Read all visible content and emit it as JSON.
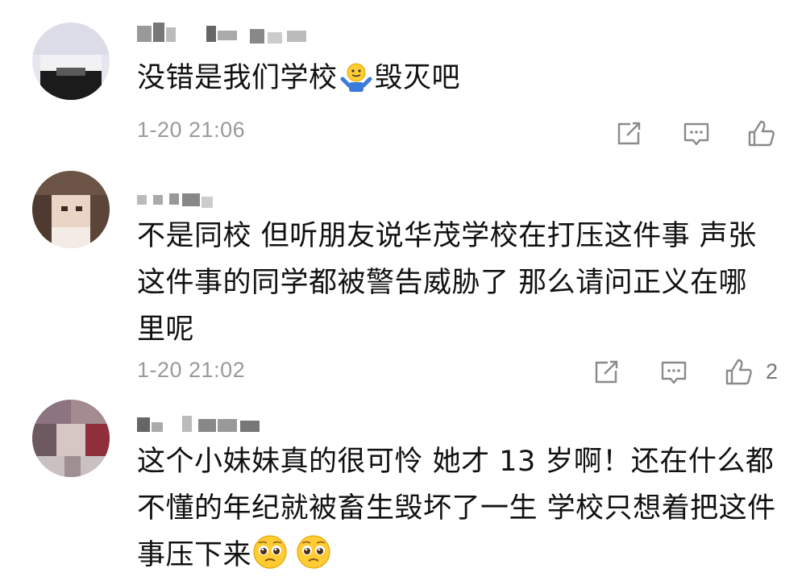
{
  "comments": [
    {
      "text_before_emoji": "没错是我们学校",
      "emoji_1": "shrug-emoji",
      "text_after_emoji": "毁灭吧",
      "time": "1-20 21:06",
      "like_count": ""
    },
    {
      "text": "不是同校 但听朋友说华茂学校在打压这件事 声张这件事的同学都被警告威胁了 那么请问正义在哪里呢",
      "time": "1-20 21:02",
      "like_count": "2"
    },
    {
      "text": "这个小妹妹真的很可怜 她才 13 岁啊！还在什么都不懂的年纪就被畜生毁坏了一生 学校只想着把这件事压下来",
      "emoji_1": "pleading-face-emoji",
      "emoji_2": "pleading-face-emoji",
      "time": "",
      "like_count": ""
    }
  ],
  "icons": {
    "share": "share-icon",
    "reply": "comment-icon",
    "like": "thumbs-up-icon"
  },
  "colors": {
    "text": "#111111",
    "meta": "#9a9a9a",
    "icon": "#8a8a8a"
  }
}
